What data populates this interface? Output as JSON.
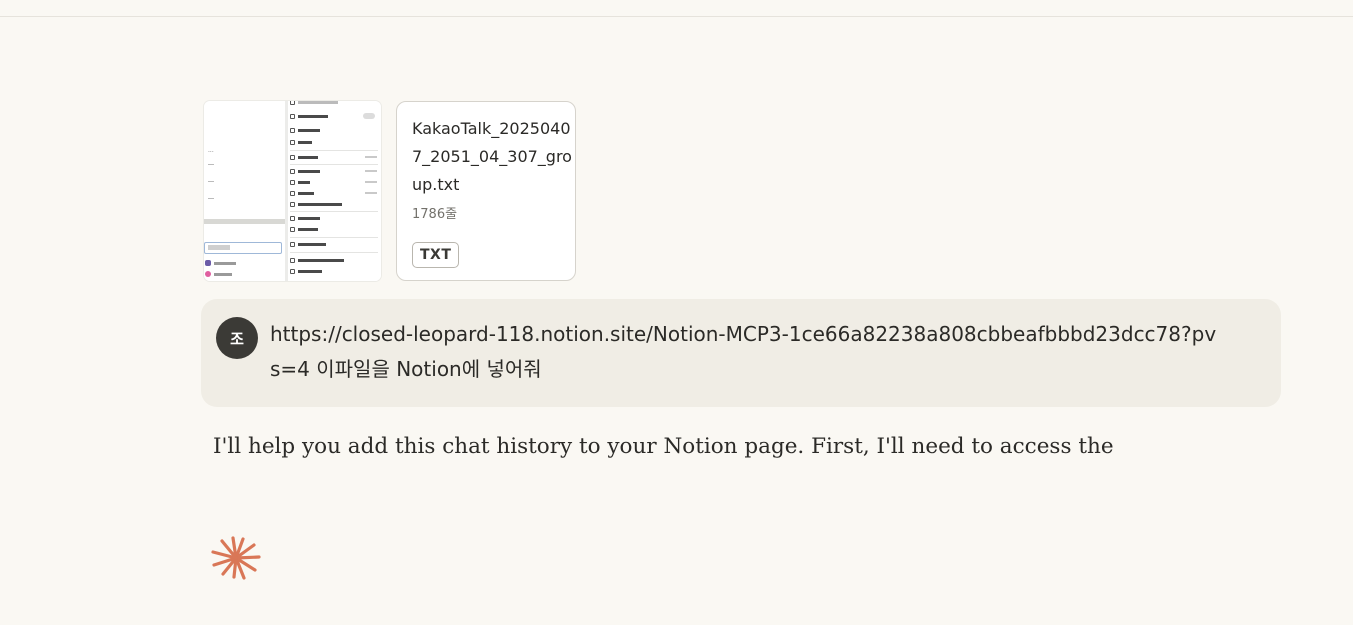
{
  "attachments": {
    "file": {
      "name": "KakaoTalk_20250407_2051_04_307_group.txt",
      "lines": "1786줄",
      "type": "TXT"
    }
  },
  "user_message": {
    "avatar_initial": "조",
    "text": "https://closed-leopard-118.notion.site/Notion-MCP3-1ce66a82238a808cbbeafbbbd23dcc78?pvs=4  이파일을 Notion에 넣어줘"
  },
  "assistant_message": {
    "text": "I'll help you add this chat history to your Notion page. First, I'll need to access the"
  },
  "colors": {
    "background": "#faf8f3",
    "bubble": "#f0ede5",
    "avatar": "#3b3a36",
    "spinner_accent": "#d97757"
  },
  "icons": {
    "status_indicator": "asterisk-spinner-icon"
  }
}
